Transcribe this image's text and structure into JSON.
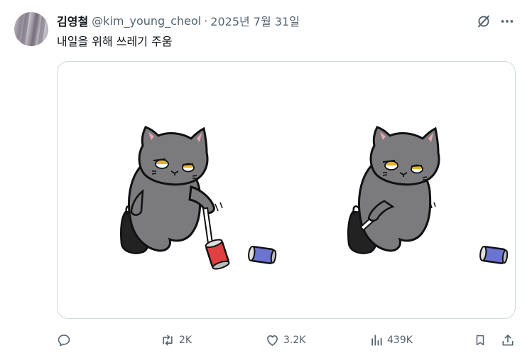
{
  "post": {
    "display_name": "김영철",
    "handle": "@kim_young_cheol",
    "separator": "·",
    "date": "2025년 7월 31일",
    "text": "내일을 위해 쓰레기 주움"
  },
  "header_icons": [
    "grok-icon",
    "more-icon"
  ],
  "actions": {
    "reply": {
      "icon": "reply-icon",
      "count": ""
    },
    "repost": {
      "icon": "repost-icon",
      "count": "2K"
    },
    "like": {
      "icon": "heart-icon",
      "count": "3.2K"
    },
    "views": {
      "icon": "views-icon",
      "count": "439K"
    },
    "bookmark": {
      "icon": "bookmark-icon"
    },
    "share": {
      "icon": "share-icon"
    }
  },
  "colors": {
    "text_primary": "#0f1419",
    "text_secondary": "#536471",
    "border": "#cfd9de",
    "cat_gray": "#7b7b7d",
    "can_red": "#e0403f",
    "can_blue": "#6b74d1"
  }
}
